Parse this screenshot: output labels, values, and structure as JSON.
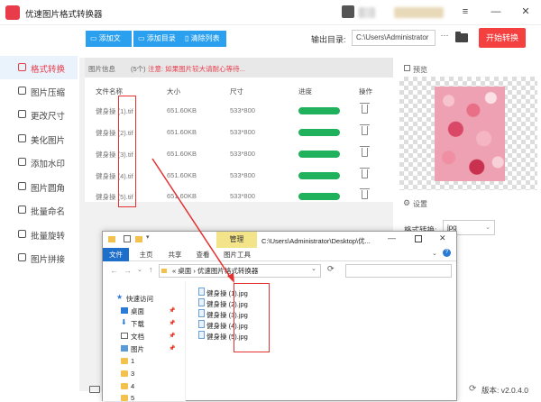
{
  "app": {
    "title": "优速图片格式转换器"
  },
  "toolbar": {
    "add_file": "添加文件",
    "add_folder": "添加目录",
    "clear_list": "清除列表",
    "output_label": "输出目录:",
    "output_path": "C:\\Users\\Administrator",
    "more_label": "···",
    "start_label": "开始转换"
  },
  "sidebar": {
    "items": [
      {
        "label": "格式转换",
        "active": true
      },
      {
        "label": "图片压缩"
      },
      {
        "label": "更改尺寸"
      },
      {
        "label": "美化图片"
      },
      {
        "label": "添加水印"
      },
      {
        "label": "图片圆角"
      },
      {
        "label": "批量命名"
      },
      {
        "label": "批量旋转"
      },
      {
        "label": "图片拼接"
      }
    ]
  },
  "list": {
    "info_label": "图片信息",
    "count": "(5个)",
    "notice": "注意: 如果图片较大请耐心等待...",
    "columns": [
      "文件名称",
      "大小",
      "尺寸",
      "进度",
      "操作"
    ],
    "rows": [
      {
        "name": "健身操 (1).tif",
        "size": "651.60KB",
        "dims": "533*800",
        "progress": 1.0
      },
      {
        "name": "健身操 (2).tif",
        "size": "651.60KB",
        "dims": "533*800",
        "progress": 1.0
      },
      {
        "name": "健身操 (3).tif",
        "size": "651.60KB",
        "dims": "533*800",
        "progress": 1.0
      },
      {
        "name": "健身操 (4).tif",
        "size": "651.60KB",
        "dims": "533*800",
        "progress": 1.0
      },
      {
        "name": "健身操 (5).tif",
        "size": "651.60KB",
        "dims": "533*800",
        "progress": 1.0
      }
    ]
  },
  "preview": {
    "title": "预览"
  },
  "settings": {
    "title": "设置",
    "format_label": "格式转换:",
    "format_value": "jpg"
  },
  "version": "版本: v2.0.4.0",
  "explorer": {
    "manage_tab": "管理",
    "window_path": "C:\\Users\\Administrator\\Desktop\\优...",
    "tabs": [
      "文件",
      "主页",
      "共享",
      "查看",
      "图片工具"
    ],
    "breadcrumb": [
      "桌面",
      "优速图片格式转换器"
    ],
    "nav": [
      {
        "label": "快速访问"
      },
      {
        "label": "桌面",
        "pinned": true
      },
      {
        "label": "下载",
        "pinned": true
      },
      {
        "label": "文档",
        "pinned": true
      },
      {
        "label": "图片",
        "pinned": true
      },
      {
        "label": "1"
      },
      {
        "label": "3"
      },
      {
        "label": "4"
      },
      {
        "label": "5"
      }
    ],
    "files": [
      "健身操 (1).jpg",
      "健身操 (2).jpg",
      "健身操 (3).jpg",
      "健身操 (4).jpg",
      "健身操 (5).jpg"
    ]
  },
  "colors": {
    "accent": "#2ba0ee",
    "start": "#f4413f",
    "progress": "#1fb15b",
    "annotation": "#e53030",
    "active": "#e83c4b"
  }
}
